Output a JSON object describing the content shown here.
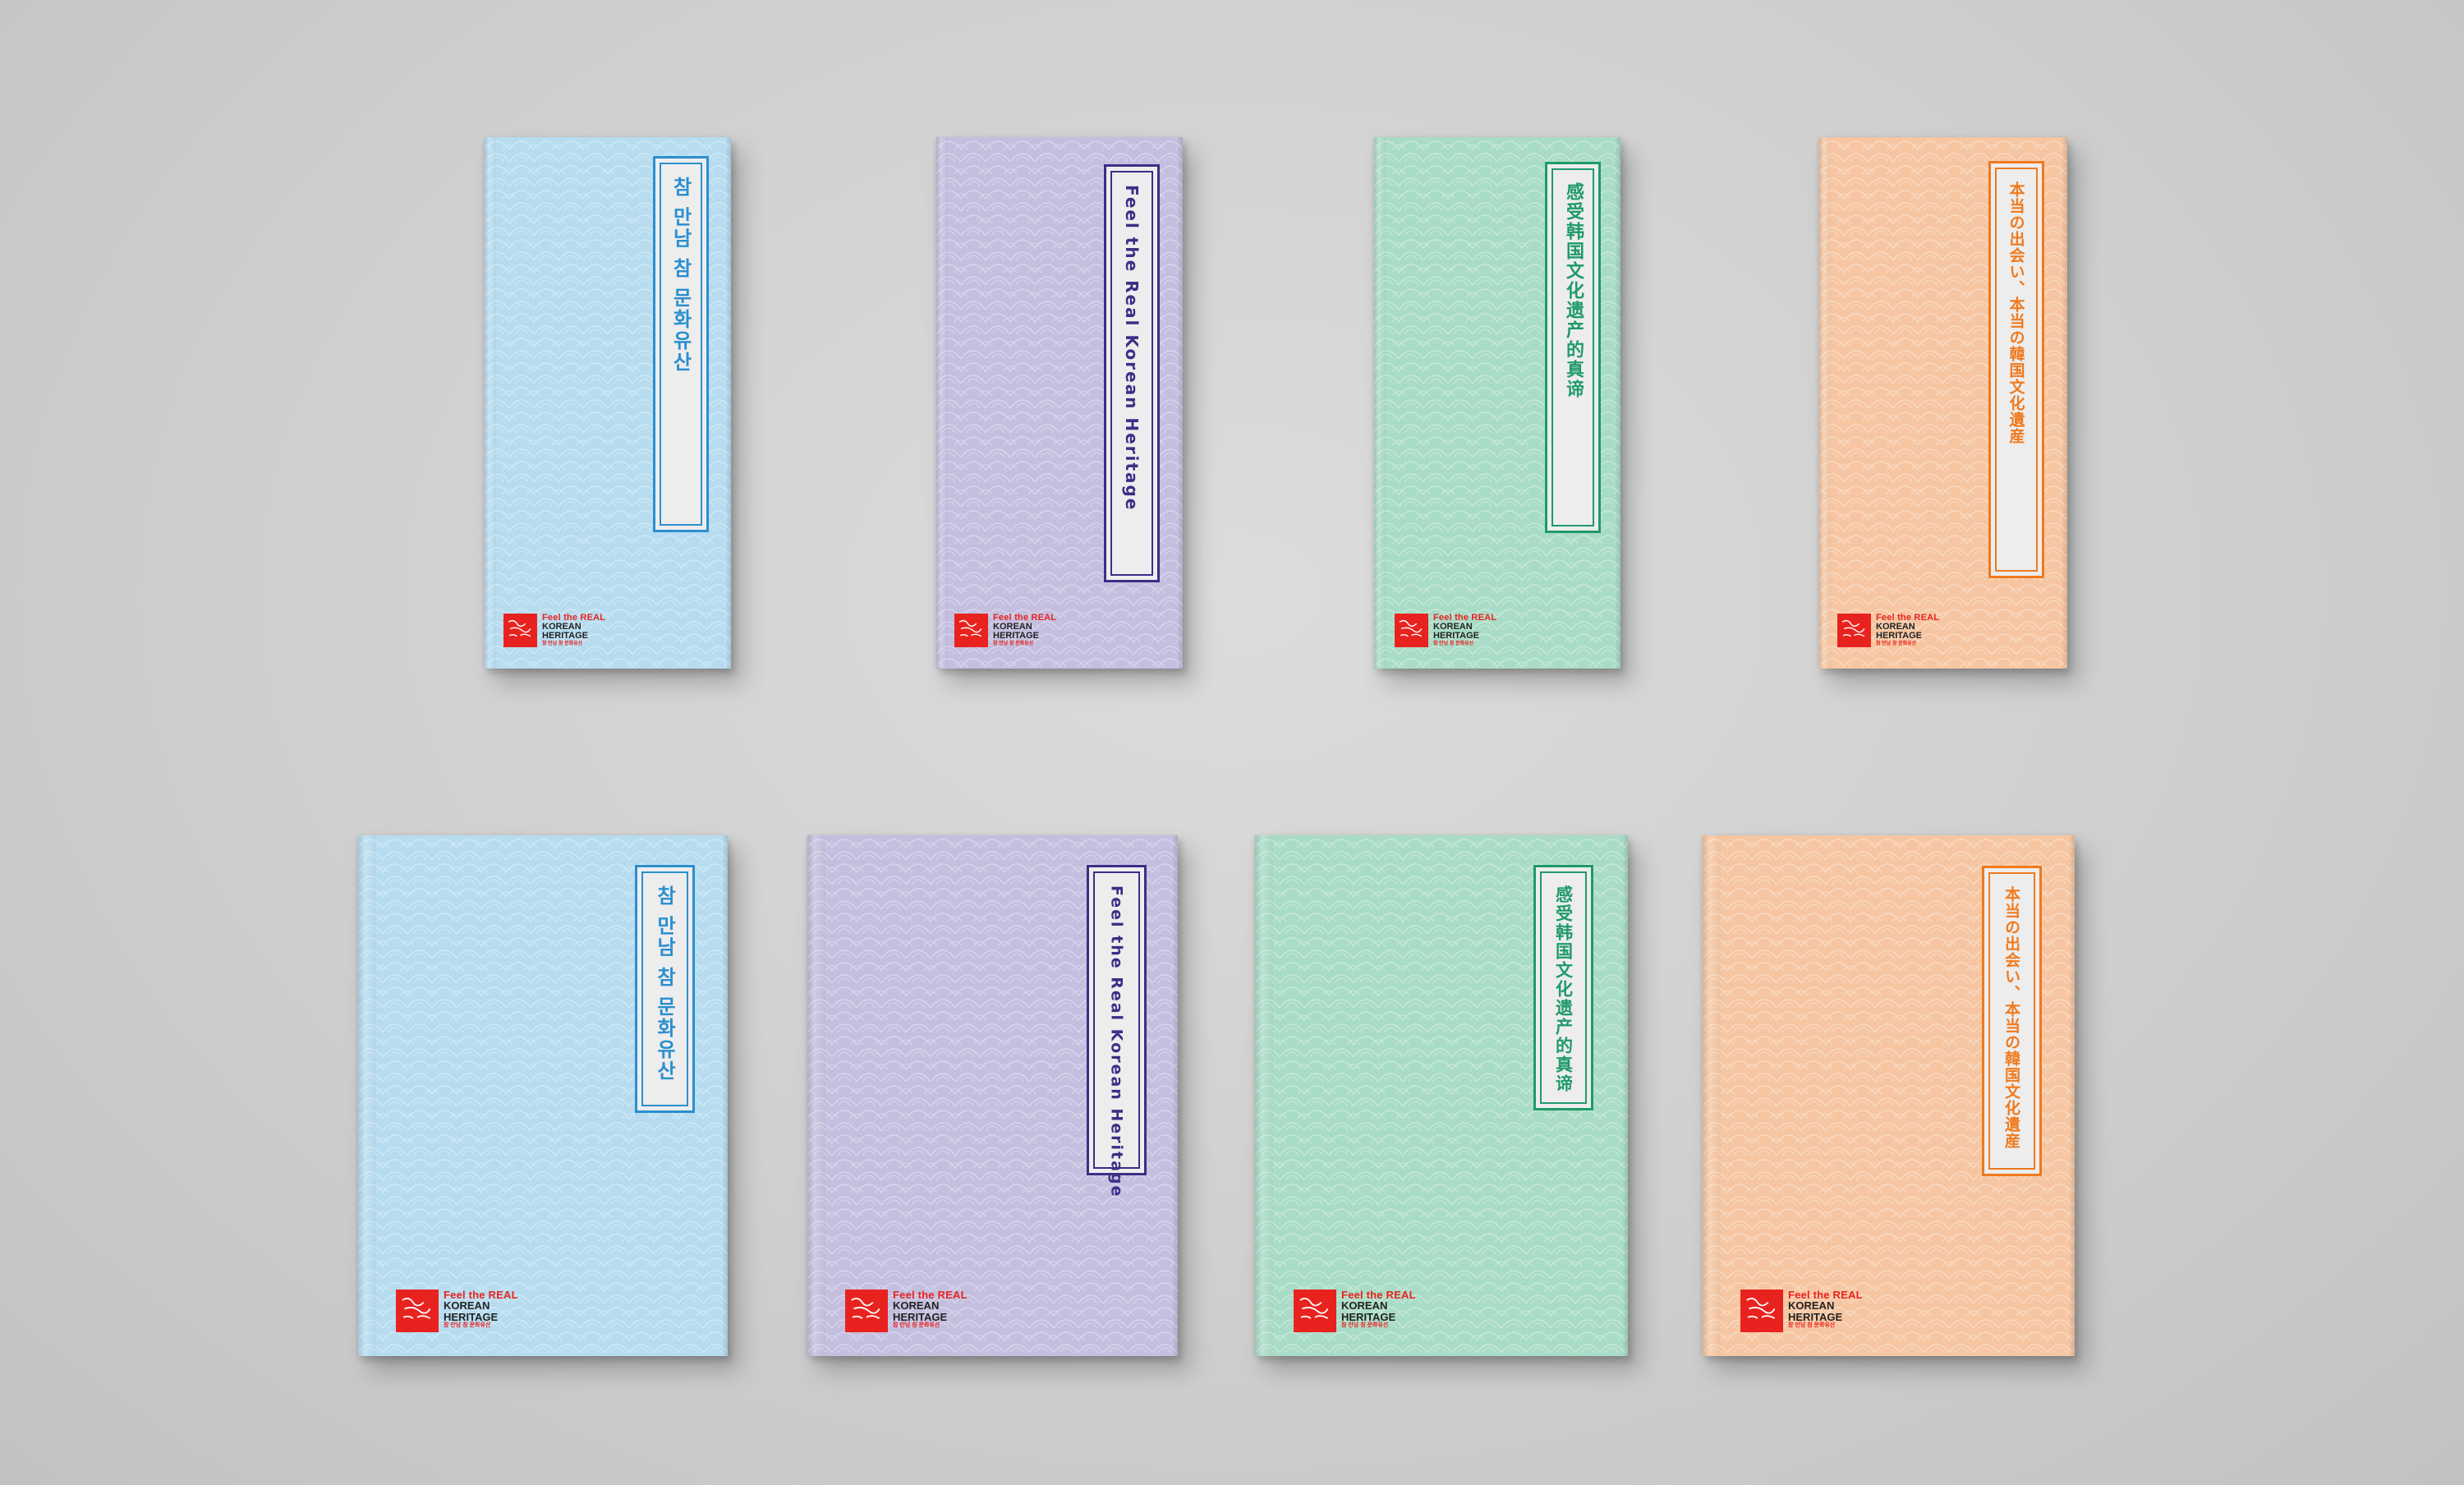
{
  "colors": {
    "background": "#d2d2d2",
    "brand_red": "#e8231f",
    "blue_cover": "#b7dcf0",
    "blue_accent": "#2a8fcf",
    "purple_cover": "#c4bfdf",
    "purple_accent": "#3b2f86",
    "green_cover": "#a9dcc6",
    "green_accent": "#1f9a6b",
    "orange_cover": "#f6c6a2",
    "orange_accent": "#f07a1e"
  },
  "brand": {
    "line1": "Feel the REAL",
    "line2": "KOREAN",
    "line3": "HERITAGE",
    "line4": "참 만남 참 문화유산"
  },
  "books": [
    {
      "id": "small-korean",
      "title": "참 만남 참 문화유산",
      "variant": "blue"
    },
    {
      "id": "small-english",
      "title": "Feel the Real Korean Heritage",
      "variant": "purple"
    },
    {
      "id": "small-chinese",
      "title": "感受韩国文化遗产的真谛",
      "variant": "green"
    },
    {
      "id": "small-japanese",
      "title": "本当の出会い、本当の韓国文化遺産",
      "variant": "orange"
    },
    {
      "id": "large-korean",
      "title": "참 만남 참 문화유산",
      "variant": "blue"
    },
    {
      "id": "large-english",
      "title": "Feel the Real Korean Heritage",
      "variant": "purple"
    },
    {
      "id": "large-chinese",
      "title": "感受韩国文化遗产的真谛",
      "variant": "green"
    },
    {
      "id": "large-japanese",
      "title": "本当の出会い、本当の韓国文化遺産",
      "variant": "orange"
    }
  ]
}
